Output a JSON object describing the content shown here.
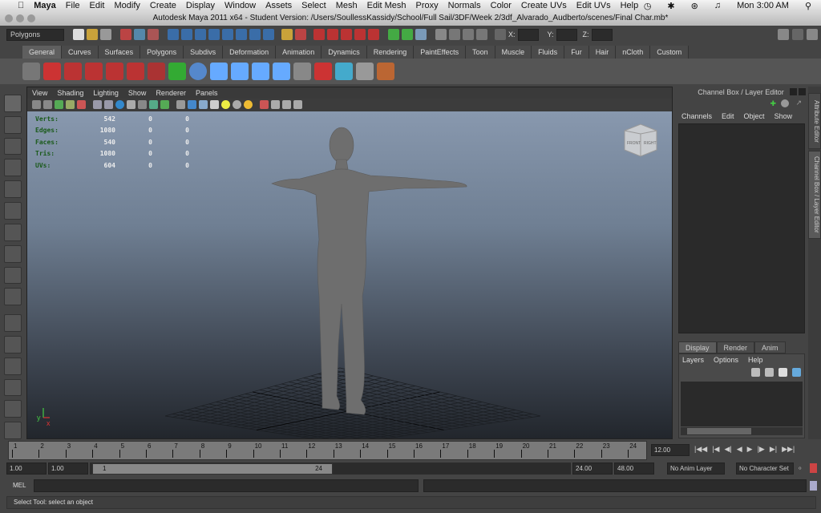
{
  "menubar": {
    "app": "Maya",
    "items": [
      "File",
      "Edit",
      "Modify",
      "Create",
      "Display",
      "Window",
      "Assets",
      "Select",
      "Mesh",
      "Edit Mesh",
      "Proxy",
      "Normals",
      "Color",
      "Create UVs",
      "Edit UVs",
      "Help"
    ],
    "clock": "Mon 3:00 AM"
  },
  "window": {
    "title": "Autodesk Maya 2011 x64 - Student Version: /Users/SoullessKassidy/School/Full Sail/3DF/Week 2/3df_Alvarado_Audberto/scenes/Final Char.mb*"
  },
  "statusline": {
    "menuset": "Polygons",
    "x_label": "X:",
    "y_label": "Y:",
    "z_label": "Z:"
  },
  "shelf": {
    "tabs": [
      "General",
      "Curves",
      "Surfaces",
      "Polygons",
      "Subdivs",
      "Deformation",
      "Animation",
      "Dynamics",
      "Rendering",
      "PaintEffects",
      "Toon",
      "Muscle",
      "Fluids",
      "Fur",
      "Hair",
      "nCloth",
      "Custom"
    ],
    "active": "General"
  },
  "viewport": {
    "menu": [
      "View",
      "Shading",
      "Lighting",
      "Show",
      "Renderer",
      "Panels"
    ],
    "hud": [
      {
        "label": "Verts:",
        "values": [
          "542",
          "0",
          "0"
        ]
      },
      {
        "label": "Edges:",
        "values": [
          "1080",
          "0",
          "0"
        ]
      },
      {
        "label": "Faces:",
        "values": [
          "540",
          "0",
          "0"
        ]
      },
      {
        "label": "Tris:",
        "values": [
          "1080",
          "0",
          "0"
        ]
      },
      {
        "label": "UVs:",
        "values": [
          "604",
          "0",
          "0"
        ]
      }
    ],
    "viewcube": {
      "front": "FRONT",
      "right": "RIGHT"
    },
    "axis": {
      "x": "x",
      "y": "y"
    }
  },
  "channelbox": {
    "title": "Channel Box / Layer Editor",
    "menu": [
      "Channels",
      "Edit",
      "Object",
      "Show"
    ],
    "layer_tabs": [
      "Display",
      "Render",
      "Anim"
    ],
    "layer_menu": [
      "Layers",
      "Options",
      "Help"
    ]
  },
  "side_tabs": [
    "Attribute Editor",
    "Channel Box / Layer Editor"
  ],
  "timeline": {
    "ticks": [
      "1",
      "2",
      "3",
      "4",
      "5",
      "6",
      "7",
      "8",
      "9",
      "10",
      "11",
      "12",
      "13",
      "14",
      "15",
      "16",
      "17",
      "18",
      "19",
      "20",
      "21",
      "22",
      "23",
      "24"
    ],
    "current": "12.00"
  },
  "range": {
    "start": "1.00",
    "playback_start": "1.00",
    "slider_start": "1",
    "slider_end": "24",
    "playback_end": "24.00",
    "end": "48.00",
    "anim_layer": "No Anim Layer",
    "character_set": "No Character Set"
  },
  "command": {
    "label": "MEL"
  },
  "help_line": "Select Tool: select an object"
}
